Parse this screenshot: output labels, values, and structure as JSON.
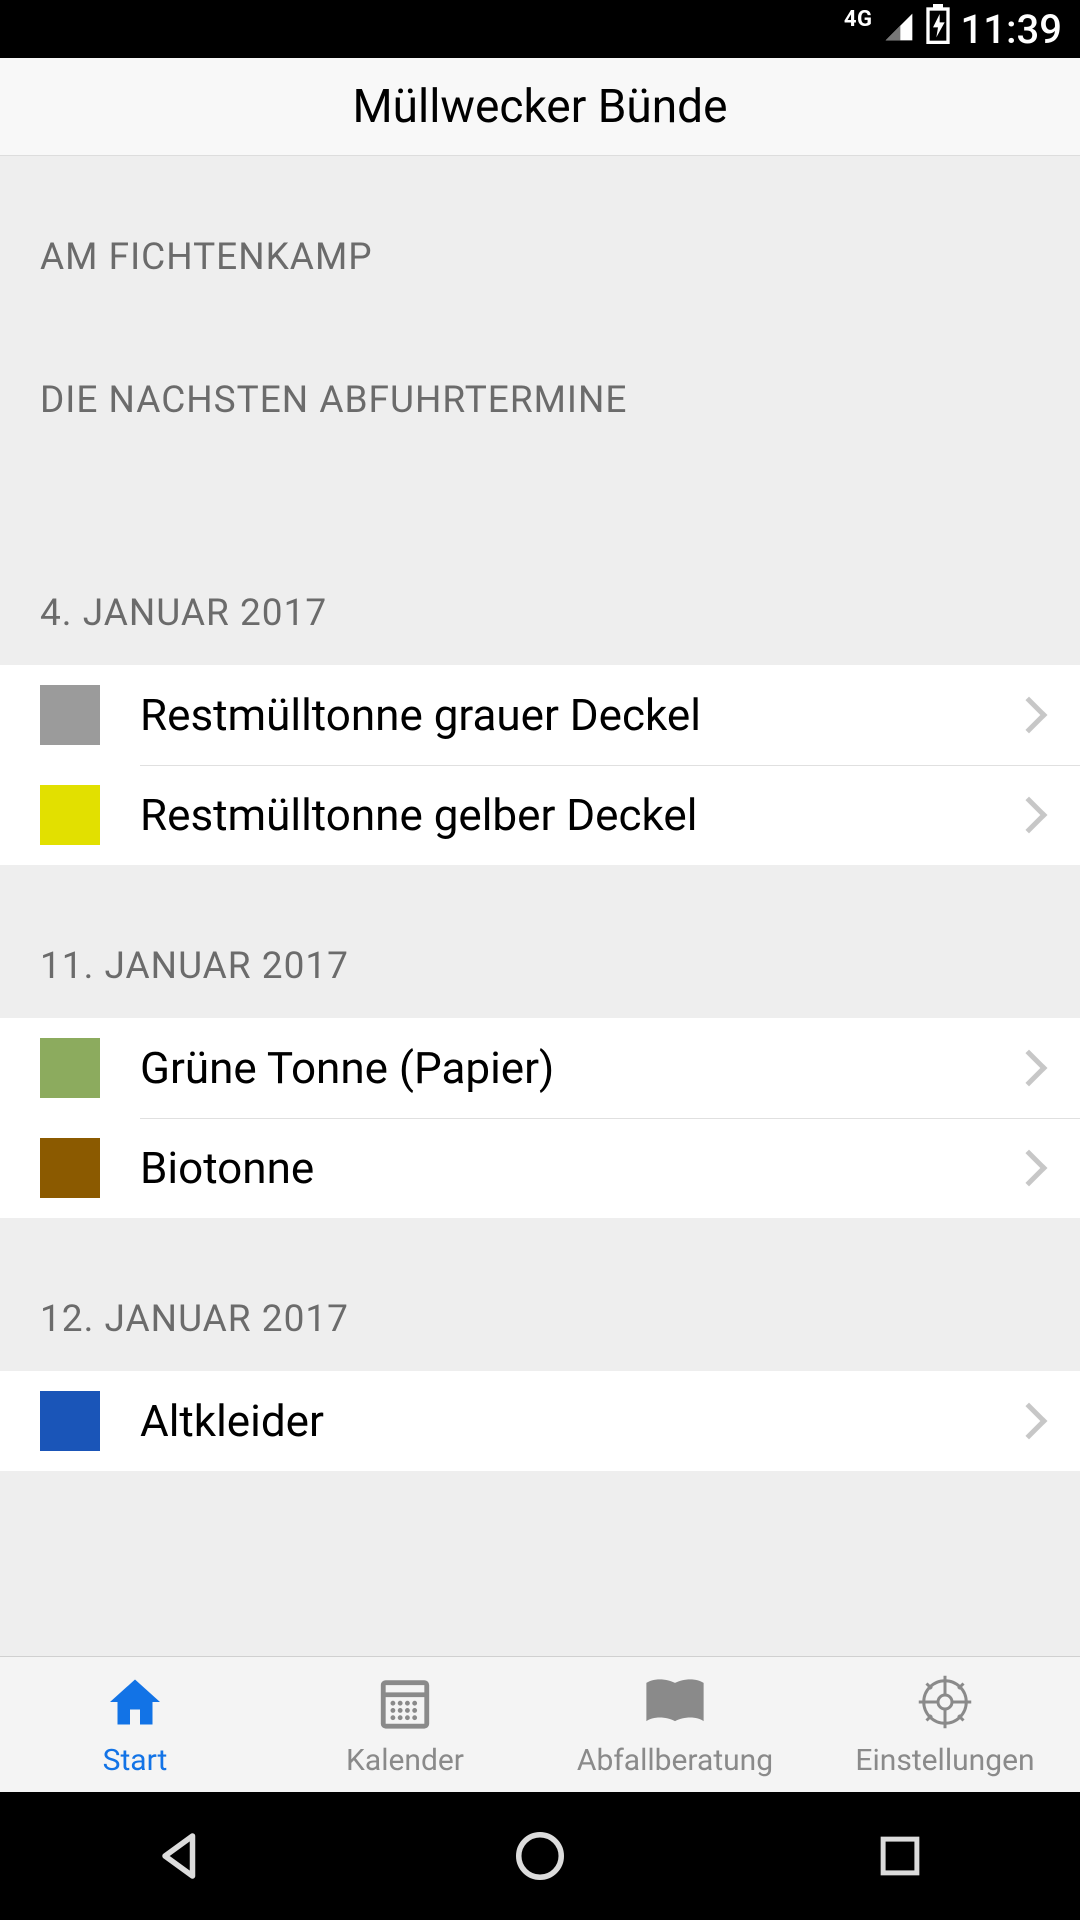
{
  "status_bar": {
    "network_label": "4G",
    "time": "11:39"
  },
  "header": {
    "title": "Müllwecker Bünde"
  },
  "address_label": "AM FICHTENKAMP",
  "upcoming_label": "DIE NACHSTEN ABFUHRTERMINE",
  "groups": [
    {
      "date_label": "4. JANUAR 2017",
      "items": [
        {
          "label": "Restmülltonne grauer Deckel",
          "color": "#9b9b9b"
        },
        {
          "label": "Restmülltonne gelber Deckel",
          "color": "#e2e000"
        }
      ]
    },
    {
      "date_label": "11. JANUAR 2017",
      "items": [
        {
          "label": "Grüne Tonne (Papier)",
          "color": "#8cab5e"
        },
        {
          "label": "Biotonne",
          "color": "#8b5a00"
        }
      ]
    },
    {
      "date_label": "12. JANUAR 2017",
      "items": [
        {
          "label": "Altkleider",
          "color": "#1a55b8"
        }
      ]
    }
  ],
  "tabs": {
    "start": "Start",
    "calendar": "Kalender",
    "advice": "Abfallberatung",
    "settings": "Einstellungen"
  }
}
